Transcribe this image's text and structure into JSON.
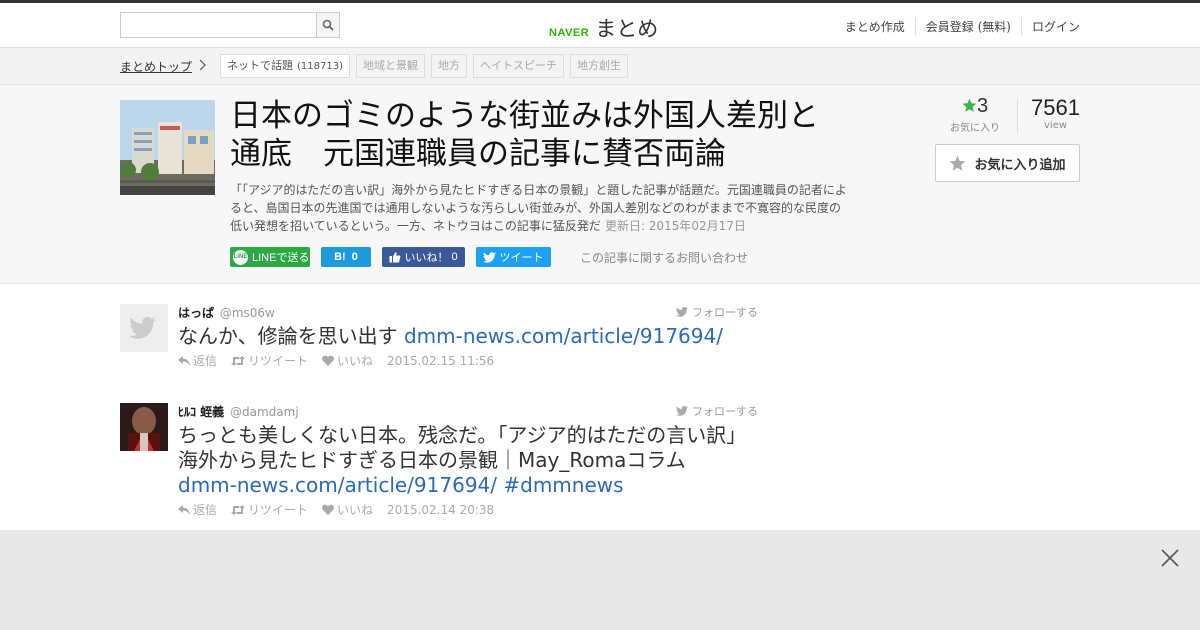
{
  "header": {
    "search_placeholder": "",
    "logo_naver": "NAVER",
    "logo_matome": "まとめ",
    "nav": [
      "まとめ作成",
      "会員登録 (無料)",
      "ログイン"
    ]
  },
  "breadcrumb": {
    "top": "まとめトップ",
    "tags": [
      {
        "label": "ネットで話題",
        "count": "(118713)"
      },
      {
        "label": "地域と景観"
      },
      {
        "label": "地方"
      },
      {
        "label": "ヘイトスピーチ"
      },
      {
        "label": "地方創生"
      }
    ]
  },
  "article": {
    "title": "日本のゴミのような街並みは外国人差別と通底　元国連職員の記事に賛否両論",
    "description": "「「アジア的はただの言い訳」海外から見たヒドすぎる日本の景観」と題した記事が話題だ。元国連職員の記者によると、島国日本の先進国では通用しないような汚らしい街並みが、外国人差別などのわがままで不寛容的な民度の低い発想を招いているという。一方、ネトウヨはこの記事に猛反発だ",
    "updated": "更新日: 2015年02月17日",
    "share": {
      "line": "LINEで送る",
      "line_icon": "LINE",
      "hatena": "B!",
      "hatena_count": "0",
      "fb": "いいね！",
      "fb_count": "0",
      "tw": "ツイート"
    },
    "contact": "この記事に関するお問い合わせ"
  },
  "stats": {
    "favorites": "3",
    "favorites_label": "お気に入り",
    "views": "7561",
    "views_label": "view",
    "fav_button": "お気に入り追加"
  },
  "tweets": [
    {
      "name": "はっぱ",
      "handle": "@ms06w",
      "follow": "フォローする",
      "text": "なんか、修論を思い出す ",
      "link": "dmm-news.com/article/917694/",
      "reply": "返信",
      "retweet": "リツイート",
      "like": "いいね",
      "date": "2015.02.15 11:56"
    },
    {
      "name": "ﾋﾙｺ 蛭義",
      "handle": "@damdamj",
      "follow": "フォローする",
      "text": "ちっとも美しくない日本。残念だ。「アジア的はただの言い訳」海外から見たヒドすぎる日本の景観｜May_Romaコラム",
      "link": "dmm-news.com/article/917694/",
      "hashtag": "#dmmnews",
      "reply": "返信",
      "retweet": "リツイート",
      "like": "いいね",
      "date": "2015.02.14 20:38"
    }
  ],
  "colors": {
    "naver_green": "#2db400",
    "link_blue": "#2a6ab8",
    "star_green": "#3bb54a"
  }
}
